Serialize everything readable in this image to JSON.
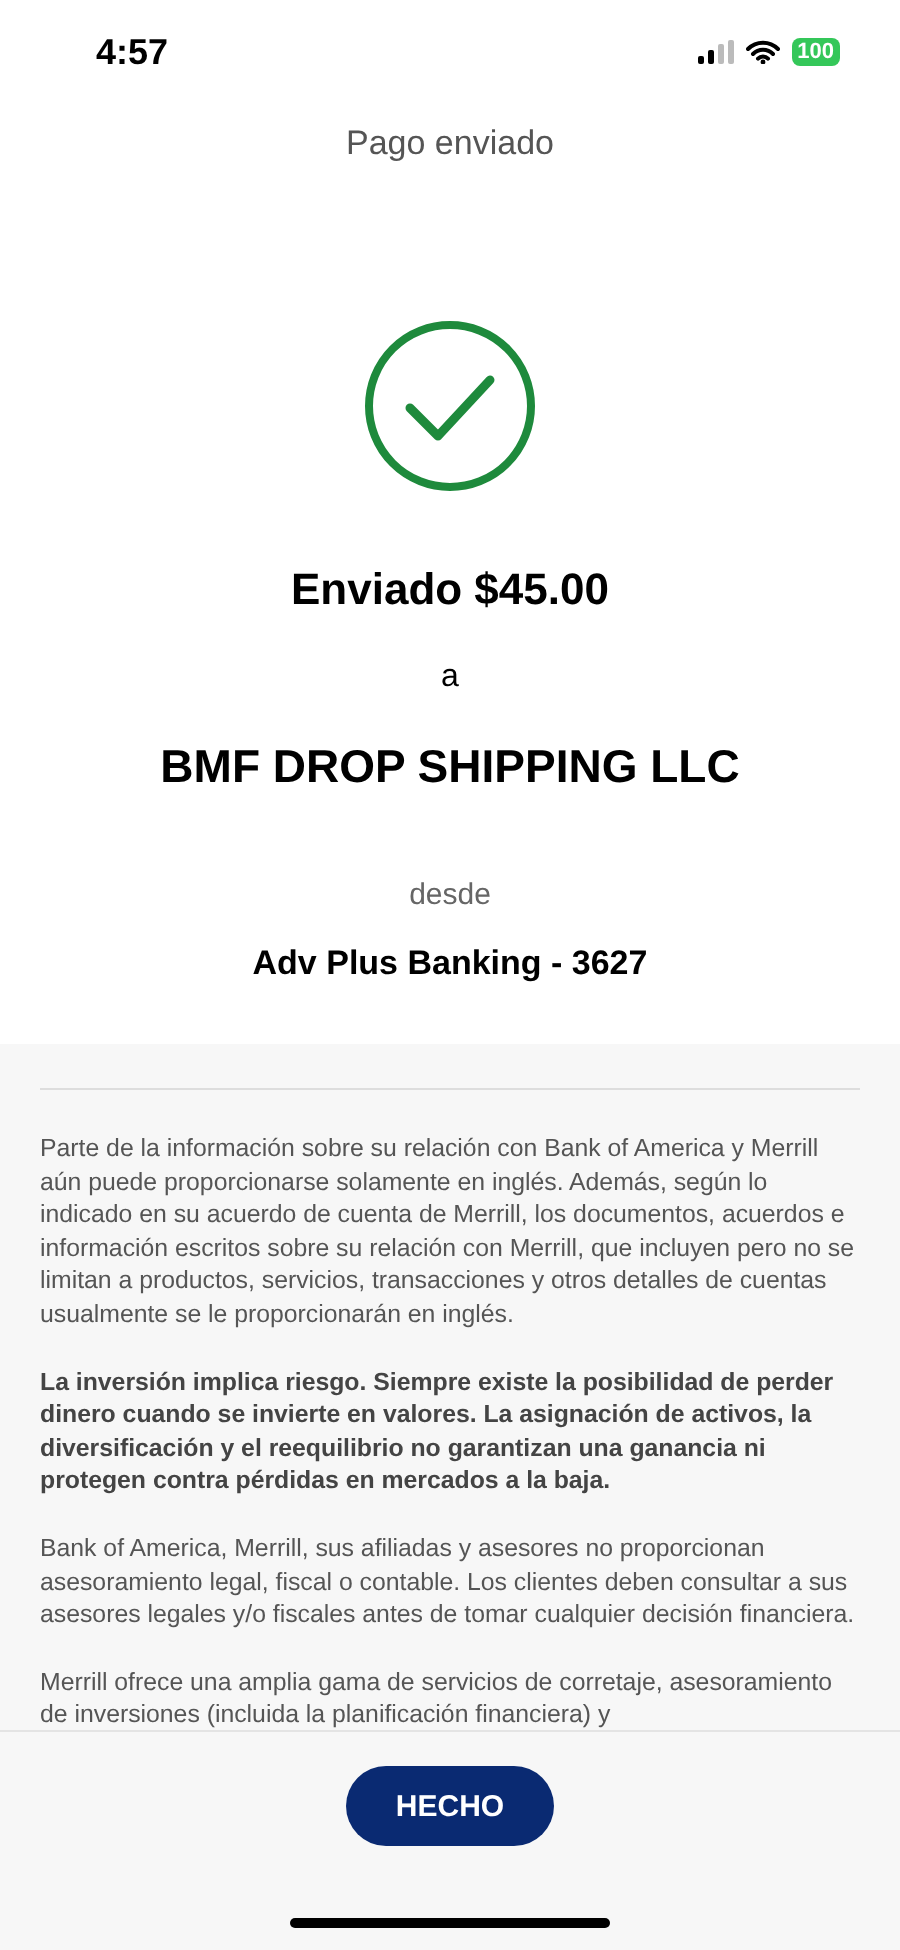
{
  "status_bar": {
    "time": "4:57",
    "battery": "100"
  },
  "header": {
    "title": "Pago enviado"
  },
  "receipt": {
    "amount_line": "Enviado $45.00",
    "to_label": "a",
    "recipient": "BMF DROP SHIPPING LLC",
    "from_label": "desde",
    "account": "Adv Plus Banking - 3627"
  },
  "disclosures": [
    {
      "kind": "normal",
      "text": "Parte de la información sobre su relación con Bank of America y Merrill aún puede proporcionarse solamente en inglés. Además, según lo indicado en su acuerdo de cuenta de Merrill, los documentos, acuerdos e información escritos sobre su relación con Merrill, que incluyen pero no se limitan a productos, servicios, transacciones y otros detalles de cuentas usualmente se le proporcionarán en inglés."
    },
    {
      "kind": "emphasis",
      "text": "La inversión implica riesgo. Siempre existe la posibilidad de perder dinero cuando se invierte en valores. La asignación de activos, la diversificación y el reequilibrio no garantizan una ganancia ni protegen contra pérdidas en mercados a la baja."
    },
    {
      "kind": "normal",
      "text": "Bank of America, Merrill, sus afiliadas y asesores no proporcionan asesoramiento legal, fiscal o contable. Los clientes deben consultar a sus asesores legales y/o fiscales antes de tomar cualquier decisión financiera."
    },
    {
      "kind": "normal",
      "text": "Merrill ofrece una amplia gama de servicios de corretaje, asesoramiento de inversiones (incluida la planificación financiera) y"
    }
  ],
  "done_button": "HECHO"
}
